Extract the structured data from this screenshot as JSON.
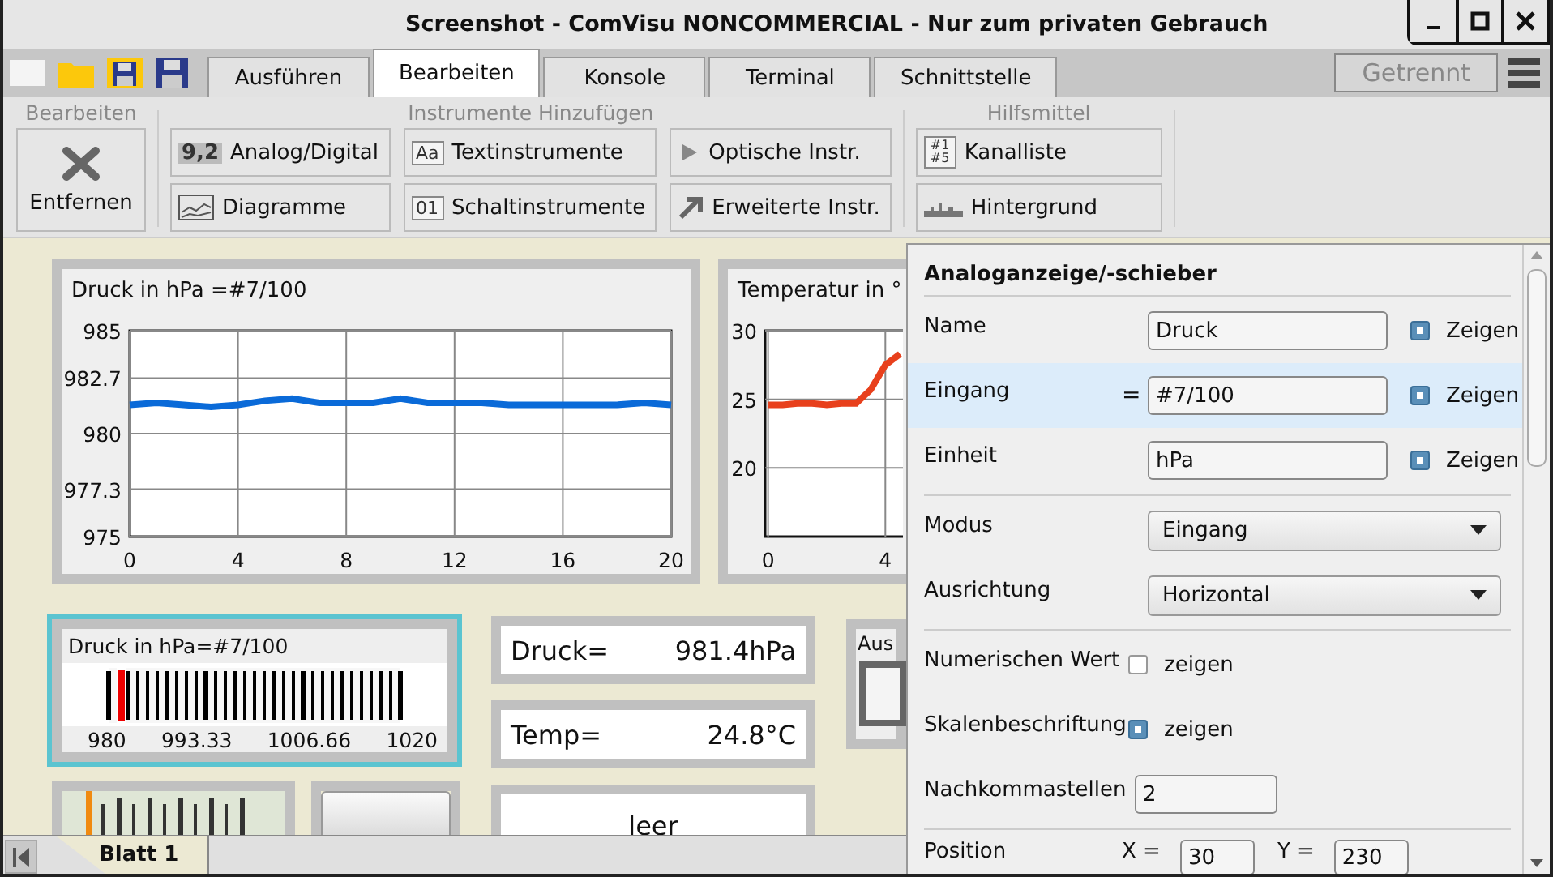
{
  "window": {
    "title": "Screenshot - ComVisu NONCOMMERCIAL - Nur zum privaten Gebrauch"
  },
  "tabs": [
    {
      "label": "Ausführen",
      "selected": false
    },
    {
      "label": "Bearbeiten",
      "selected": true
    },
    {
      "label": "Konsole",
      "selected": false
    },
    {
      "label": "Terminal",
      "selected": false
    },
    {
      "label": "Schnittstelle",
      "selected": false
    }
  ],
  "connection_status": "Getrennt",
  "ribbon": {
    "groups": [
      {
        "title": "Bearbeiten",
        "buttons": [
          {
            "label": "Entfernen",
            "kind": "large"
          }
        ]
      },
      {
        "title": "Instrumente Hinzufügen",
        "buttons": [
          {
            "label": "Analog/Digital",
            "kind": "small",
            "icon_text": "9,2"
          },
          {
            "label": "Diagramme",
            "kind": "small"
          },
          {
            "label": "Textinstrumente",
            "kind": "small",
            "icon_text": "Aa"
          },
          {
            "label": "Schaltinstrumente",
            "kind": "small",
            "icon_text": "01"
          },
          {
            "label": "Optische Instr.",
            "kind": "small"
          },
          {
            "label": "Erweiterte Instr.",
            "kind": "small"
          }
        ]
      },
      {
        "title": "Hilfsmittel",
        "buttons": [
          {
            "label": "Kanalliste",
            "kind": "small",
            "icon_text": "#1 #5"
          },
          {
            "label": "Hintergrund",
            "kind": "small"
          }
        ]
      }
    ]
  },
  "canvas": {
    "charts": [
      {
        "title": "Druck in hPa =#7/100",
        "chart_data": {
          "type": "line",
          "x": [
            0,
            1,
            2,
            3,
            4,
            5,
            6,
            7,
            8,
            9,
            10,
            11,
            12,
            13,
            14,
            15,
            16,
            17,
            18,
            19,
            20
          ],
          "series": [
            {
              "color": "#0a6ad8",
              "values": [
                981.4,
                981.5,
                981.4,
                981.3,
                981.4,
                981.6,
                981.7,
                981.5,
                981.5,
                981.5,
                981.7,
                981.5,
                981.5,
                981.5,
                981.4,
                981.4,
                981.4,
                981.4,
                981.4,
                981.5,
                981.4
              ]
            }
          ],
          "xlim": [
            0,
            20
          ],
          "ylim": [
            975,
            985
          ],
          "xticks": [
            0,
            4,
            8,
            12,
            16,
            20
          ],
          "yticks": [
            975,
            977.3,
            980,
            982.7,
            985
          ],
          "grid": true
        }
      },
      {
        "title": "Temperatur in °",
        "chart_data": {
          "type": "line",
          "x": [
            0,
            0.5,
            1,
            1.5,
            2,
            2.5,
            3,
            3.5,
            4,
            4.5
          ],
          "series": [
            {
              "color": "#e8401c",
              "values": [
                24.6,
                24.6,
                24.7,
                24.7,
                24.6,
                24.7,
                24.7,
                25.7,
                27.5,
                28.3
              ]
            }
          ],
          "xlim": [
            -0.1,
            4.6
          ],
          "ylim": [
            15,
            30
          ],
          "xticks": [
            0,
            4
          ],
          "yticks": [
            20,
            25,
            30
          ],
          "grid": true
        }
      }
    ],
    "bar_gauge": {
      "title": "Druck in hPa=#7/100",
      "level": 0.035,
      "scale_labels": [
        "980",
        "993.33",
        "1006.66",
        "1020"
      ]
    },
    "displays": [
      {
        "label": "Druck=",
        "value": "981.4hPa"
      },
      {
        "label": "Temp=",
        "value": "24.8°C"
      },
      {
        "value": "leer"
      }
    ],
    "switch_box": {
      "title": "Aus"
    },
    "slider_gauge": {
      "level": 0
    }
  },
  "properties": {
    "title": "Analoganzeige/-schieber",
    "groups": [
      [
        {
          "kind": "field",
          "label": "Name",
          "value": "Druck",
          "selected": false,
          "check": {
            "label": "Zeigen",
            "checked": true
          }
        },
        {
          "kind": "field",
          "label": "Eingang",
          "prefix": "=",
          "value": "#7/100",
          "selected": true,
          "check": {
            "label": "Zeigen",
            "checked": true
          }
        },
        {
          "kind": "field",
          "label": "Einheit",
          "value": "hPa",
          "selected": false,
          "check": {
            "label": "Zeigen",
            "checked": true
          }
        }
      ],
      [
        {
          "kind": "select",
          "label": "Modus",
          "value": "Eingang",
          "selected": false
        },
        {
          "kind": "select",
          "label": "Ausrichtung",
          "value": "Horizontal",
          "selected": false
        }
      ],
      [
        {
          "kind": "check",
          "label": "Numerischen Wert",
          "selected": false,
          "check": {
            "label": "zeigen",
            "checked": false
          }
        },
        {
          "kind": "check",
          "label": "Skalenbeschriftung",
          "selected": false,
          "check": {
            "label": "zeigen",
            "checked": true
          }
        },
        {
          "kind": "number",
          "label": "Nachkommastellen",
          "value": "2",
          "selected": false
        }
      ],
      [
        {
          "kind": "position",
          "label": "Position",
          "selected": false,
          "coords": [
            {
              "label": "X =",
              "value": "30"
            },
            {
              "label": "Y =",
              "value": "230"
            }
          ]
        }
      ]
    ]
  },
  "sheets": [
    {
      "label": "Blatt 1",
      "selected": true
    }
  ]
}
